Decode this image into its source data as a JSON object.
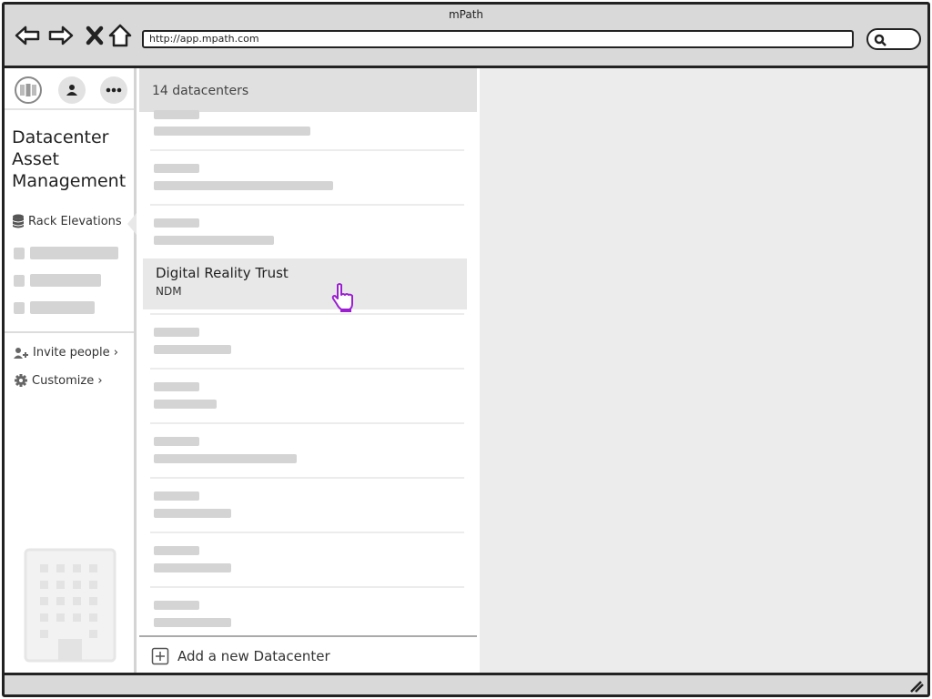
{
  "window": {
    "title": "mPath"
  },
  "browser": {
    "url": "http://app.mpath.com",
    "nav": [
      "back-icon",
      "forward-icon",
      "stop-icon",
      "home-icon"
    ],
    "search_icon": "search-icon"
  },
  "sidebar": {
    "top_icons": [
      "apps-icon",
      "user-icon",
      "more-icon"
    ],
    "app_title": "Datacenter\nAsset\nManagement",
    "active_item": {
      "label": "Rack Elevations",
      "icon": "database-icon"
    },
    "links": [
      {
        "label": "Invite people ›",
        "icon": "add-user-icon"
      },
      {
        "label": "Customize ›",
        "icon": "gear-icon"
      }
    ],
    "illustration": "building-icon"
  },
  "list": {
    "header": "14 datacenters",
    "selected": {
      "title": "Digital Reality Trust",
      "subtitle": "NDM"
    },
    "add_label": "Add a new Datacenter"
  },
  "colors": {
    "chrome": "#d9d9d9",
    "placeholder": "#d4d4d4",
    "selected_row": "#e8e8e8",
    "detail_bg": "#ececec",
    "cursor": "#9b1fd1"
  }
}
